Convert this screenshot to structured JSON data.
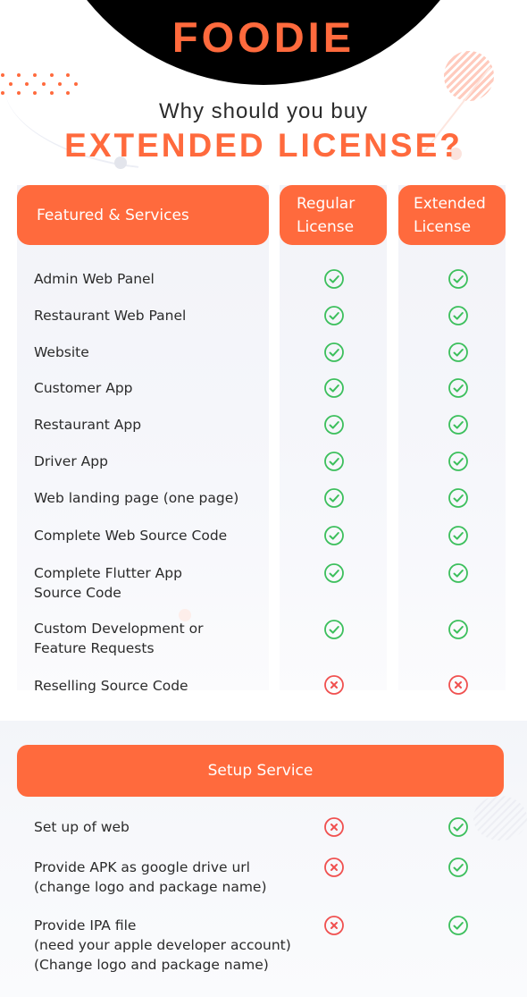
{
  "brand": "FOODIE",
  "subtitle": "Why should you buy",
  "headline": "EXTENDED LICENSE?",
  "colors": {
    "accent": "#ff6a3d",
    "check": "#3cbf5c",
    "cross": "#f0504f"
  },
  "table": {
    "headers": {
      "features": "Featured & Services",
      "regular": [
        "Regular",
        "License"
      ],
      "extended": [
        "Extended",
        "License"
      ]
    },
    "rows": [
      {
        "label": [
          "Admin Web Panel"
        ],
        "regular": "check-icon",
        "extended": "check-icon"
      },
      {
        "label": [
          "Restaurant Web Panel"
        ],
        "regular": "check-icon",
        "extended": "check-icon"
      },
      {
        "label": [
          "Website"
        ],
        "regular": "check-icon",
        "extended": "check-icon"
      },
      {
        "label": [
          "Customer App"
        ],
        "regular": "check-icon",
        "extended": "check-icon"
      },
      {
        "label": [
          "Restaurant App"
        ],
        "regular": "check-icon",
        "extended": "check-icon"
      },
      {
        "label": [
          "Driver App"
        ],
        "regular": "check-icon",
        "extended": "check-icon"
      },
      {
        "label": [
          "Web landing page (one page)"
        ],
        "regular": "check-icon",
        "extended": "check-icon"
      },
      {
        "label": [
          "Complete Web Source Code"
        ],
        "regular": "check-icon",
        "extended": "check-icon"
      },
      {
        "label": [
          "Complete Flutter App",
          "Source Code"
        ],
        "regular": "check-icon",
        "extended": "check-icon"
      },
      {
        "label": [
          "Custom Development or",
          "Feature Requests"
        ],
        "regular": "check-icon",
        "extended": "check-icon"
      },
      {
        "label": [
          "Reselling Source Code"
        ],
        "regular": "cross-icon",
        "extended": "cross-icon"
      }
    ]
  },
  "setup": {
    "title": "Setup Service",
    "rows": [
      {
        "label": [
          "Set up of web"
        ],
        "regular": "cross-icon",
        "extended": "check-icon"
      },
      {
        "label": [
          "Provide APK as google drive url",
          "(change logo and package name)"
        ],
        "regular": "cross-icon",
        "extended": "check-icon"
      },
      {
        "label": [
          "Provide IPA file",
          "(need your apple developer account)",
          "(Change logo and package name)"
        ],
        "regular": "cross-icon",
        "extended": "check-icon"
      }
    ]
  }
}
